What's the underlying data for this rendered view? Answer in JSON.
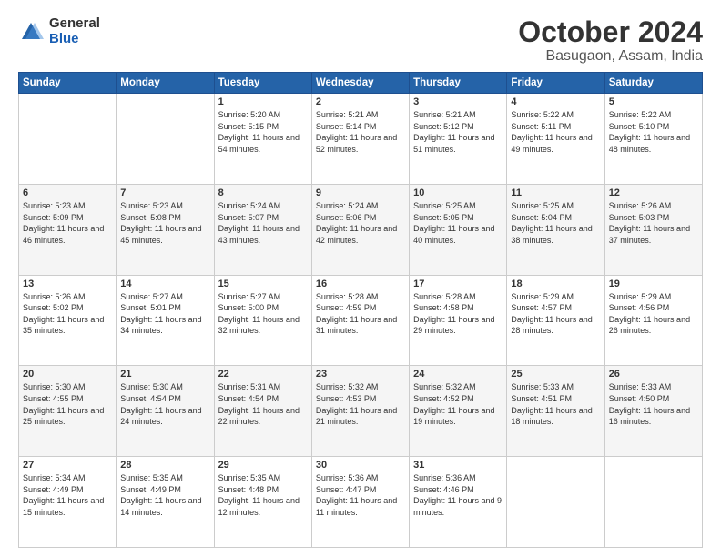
{
  "header": {
    "logo_general": "General",
    "logo_blue": "Blue",
    "title": "October 2024",
    "subtitle": "Basugaon, Assam, India"
  },
  "weekdays": [
    "Sunday",
    "Monday",
    "Tuesday",
    "Wednesday",
    "Thursday",
    "Friday",
    "Saturday"
  ],
  "weeks": [
    [
      {
        "day": "",
        "info": ""
      },
      {
        "day": "",
        "info": ""
      },
      {
        "day": "1",
        "info": "Sunrise: 5:20 AM\nSunset: 5:15 PM\nDaylight: 11 hours and 54 minutes."
      },
      {
        "day": "2",
        "info": "Sunrise: 5:21 AM\nSunset: 5:14 PM\nDaylight: 11 hours and 52 minutes."
      },
      {
        "day": "3",
        "info": "Sunrise: 5:21 AM\nSunset: 5:12 PM\nDaylight: 11 hours and 51 minutes."
      },
      {
        "day": "4",
        "info": "Sunrise: 5:22 AM\nSunset: 5:11 PM\nDaylight: 11 hours and 49 minutes."
      },
      {
        "day": "5",
        "info": "Sunrise: 5:22 AM\nSunset: 5:10 PM\nDaylight: 11 hours and 48 minutes."
      }
    ],
    [
      {
        "day": "6",
        "info": "Sunrise: 5:23 AM\nSunset: 5:09 PM\nDaylight: 11 hours and 46 minutes."
      },
      {
        "day": "7",
        "info": "Sunrise: 5:23 AM\nSunset: 5:08 PM\nDaylight: 11 hours and 45 minutes."
      },
      {
        "day": "8",
        "info": "Sunrise: 5:24 AM\nSunset: 5:07 PM\nDaylight: 11 hours and 43 minutes."
      },
      {
        "day": "9",
        "info": "Sunrise: 5:24 AM\nSunset: 5:06 PM\nDaylight: 11 hours and 42 minutes."
      },
      {
        "day": "10",
        "info": "Sunrise: 5:25 AM\nSunset: 5:05 PM\nDaylight: 11 hours and 40 minutes."
      },
      {
        "day": "11",
        "info": "Sunrise: 5:25 AM\nSunset: 5:04 PM\nDaylight: 11 hours and 38 minutes."
      },
      {
        "day": "12",
        "info": "Sunrise: 5:26 AM\nSunset: 5:03 PM\nDaylight: 11 hours and 37 minutes."
      }
    ],
    [
      {
        "day": "13",
        "info": "Sunrise: 5:26 AM\nSunset: 5:02 PM\nDaylight: 11 hours and 35 minutes."
      },
      {
        "day": "14",
        "info": "Sunrise: 5:27 AM\nSunset: 5:01 PM\nDaylight: 11 hours and 34 minutes."
      },
      {
        "day": "15",
        "info": "Sunrise: 5:27 AM\nSunset: 5:00 PM\nDaylight: 11 hours and 32 minutes."
      },
      {
        "day": "16",
        "info": "Sunrise: 5:28 AM\nSunset: 4:59 PM\nDaylight: 11 hours and 31 minutes."
      },
      {
        "day": "17",
        "info": "Sunrise: 5:28 AM\nSunset: 4:58 PM\nDaylight: 11 hours and 29 minutes."
      },
      {
        "day": "18",
        "info": "Sunrise: 5:29 AM\nSunset: 4:57 PM\nDaylight: 11 hours and 28 minutes."
      },
      {
        "day": "19",
        "info": "Sunrise: 5:29 AM\nSunset: 4:56 PM\nDaylight: 11 hours and 26 minutes."
      }
    ],
    [
      {
        "day": "20",
        "info": "Sunrise: 5:30 AM\nSunset: 4:55 PM\nDaylight: 11 hours and 25 minutes."
      },
      {
        "day": "21",
        "info": "Sunrise: 5:30 AM\nSunset: 4:54 PM\nDaylight: 11 hours and 24 minutes."
      },
      {
        "day": "22",
        "info": "Sunrise: 5:31 AM\nSunset: 4:54 PM\nDaylight: 11 hours and 22 minutes."
      },
      {
        "day": "23",
        "info": "Sunrise: 5:32 AM\nSunset: 4:53 PM\nDaylight: 11 hours and 21 minutes."
      },
      {
        "day": "24",
        "info": "Sunrise: 5:32 AM\nSunset: 4:52 PM\nDaylight: 11 hours and 19 minutes."
      },
      {
        "day": "25",
        "info": "Sunrise: 5:33 AM\nSunset: 4:51 PM\nDaylight: 11 hours and 18 minutes."
      },
      {
        "day": "26",
        "info": "Sunrise: 5:33 AM\nSunset: 4:50 PM\nDaylight: 11 hours and 16 minutes."
      }
    ],
    [
      {
        "day": "27",
        "info": "Sunrise: 5:34 AM\nSunset: 4:49 PM\nDaylight: 11 hours and 15 minutes."
      },
      {
        "day": "28",
        "info": "Sunrise: 5:35 AM\nSunset: 4:49 PM\nDaylight: 11 hours and 14 minutes."
      },
      {
        "day": "29",
        "info": "Sunrise: 5:35 AM\nSunset: 4:48 PM\nDaylight: 11 hours and 12 minutes."
      },
      {
        "day": "30",
        "info": "Sunrise: 5:36 AM\nSunset: 4:47 PM\nDaylight: 11 hours and 11 minutes."
      },
      {
        "day": "31",
        "info": "Sunrise: 5:36 AM\nSunset: 4:46 PM\nDaylight: 11 hours and 9 minutes."
      },
      {
        "day": "",
        "info": ""
      },
      {
        "day": "",
        "info": ""
      }
    ]
  ]
}
